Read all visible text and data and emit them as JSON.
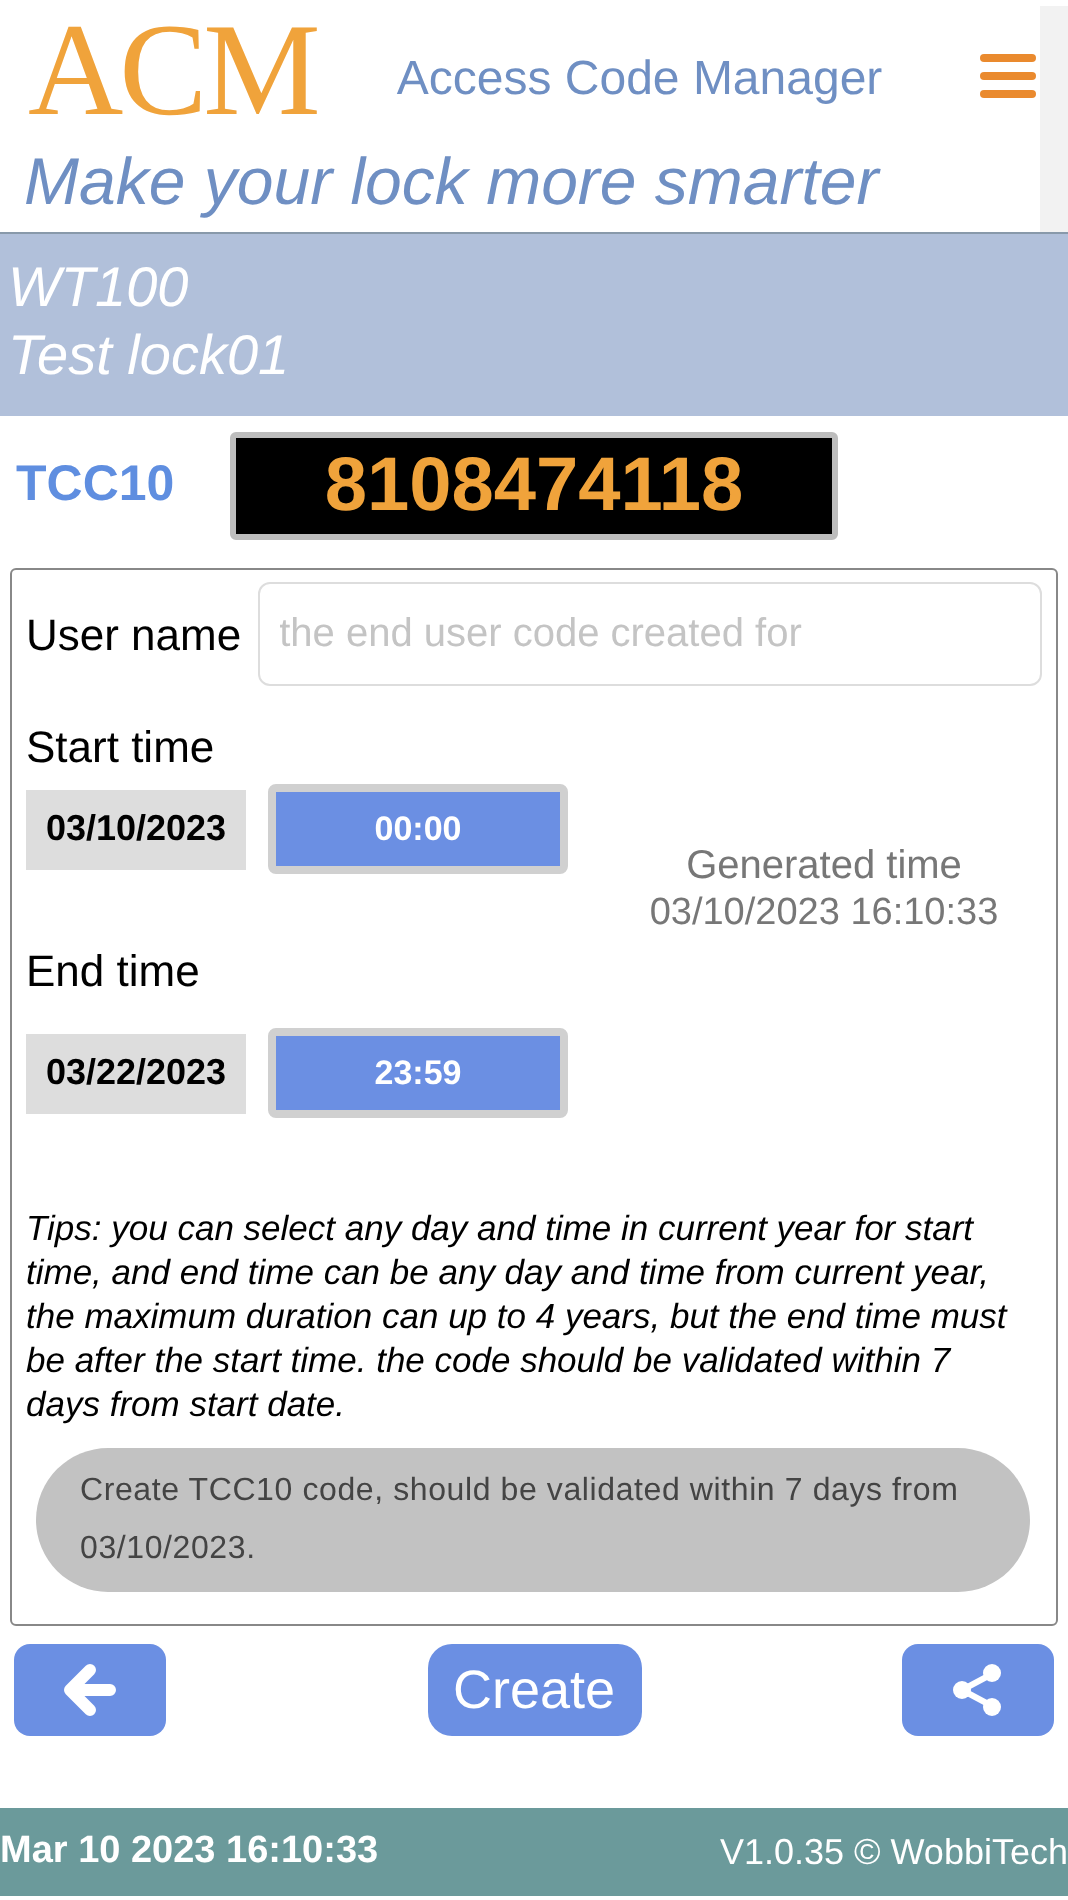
{
  "header": {
    "logo": "ACM",
    "app_title": "Access Code Manager",
    "tagline": "Make your lock more smarter"
  },
  "lock": {
    "model": "WT100",
    "name": "Test lock01"
  },
  "code": {
    "type": "TCC10",
    "value": "8108474118"
  },
  "form": {
    "user_name": {
      "label": "User name",
      "placeholder": "the end user code created for"
    },
    "start": {
      "label": "Start time",
      "date": "03/10/2023",
      "time": "00:00"
    },
    "end": {
      "label": "End time",
      "date": "03/22/2023",
      "time": "23:59"
    },
    "generated": {
      "label": "Generated time",
      "value": "03/10/2023 16:10:33"
    },
    "tips": "Tips: you can select any day and time in current year for start time, and end time can be any day and time from current year, the maximum duration can up to 4 years, but the end time must be after the start time. the code should be validated within 7 days from start date."
  },
  "toast": "Create TCC10 code, should be validated within 7 days from 03/10/2023.",
  "actions": [
    {
      "kind": "back"
    },
    {
      "kind": "text",
      "label": "Create"
    },
    {
      "kind": "share"
    }
  ],
  "status_bar": {
    "datetime": "Mar 10 2023 16:10:33",
    "version": "V1.0.35 © WobbiTech"
  }
}
